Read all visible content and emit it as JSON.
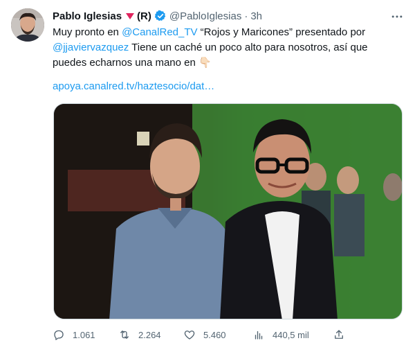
{
  "author": {
    "name": "Pablo Iglesias",
    "party": "(R)",
    "handle": "@PabloIglesias",
    "separator": "·",
    "time": "3h"
  },
  "tweet": {
    "line1_prefix": "Muy pronto en ",
    "line1_mention": "@CanalRed_TV",
    "line1_suffix": " “Rojos y Maricones” presentado por",
    "line2_mention": "@jjaviervazquez",
    "line2_suffix": " Tiene un caché un poco alto para nosotros, así que",
    "line3": "puedes echarnos una mano en",
    "hand_emoji": "👇🏻",
    "url": "apoya.canalred.tv/haztesocio/dat…"
  },
  "actions": {
    "replies": "1.061",
    "retweets": "2.264",
    "likes": "5.460",
    "views": "440,5 mil"
  },
  "colors": {
    "link": "#1d9bf0",
    "muted": "#536471",
    "verified": "#1d9bf0",
    "party_triangle": "#e0245e"
  },
  "icons": [
    "more-icon",
    "verified-badge-icon",
    "reply-icon",
    "retweet-icon",
    "like-icon",
    "views-icon",
    "share-icon"
  ]
}
